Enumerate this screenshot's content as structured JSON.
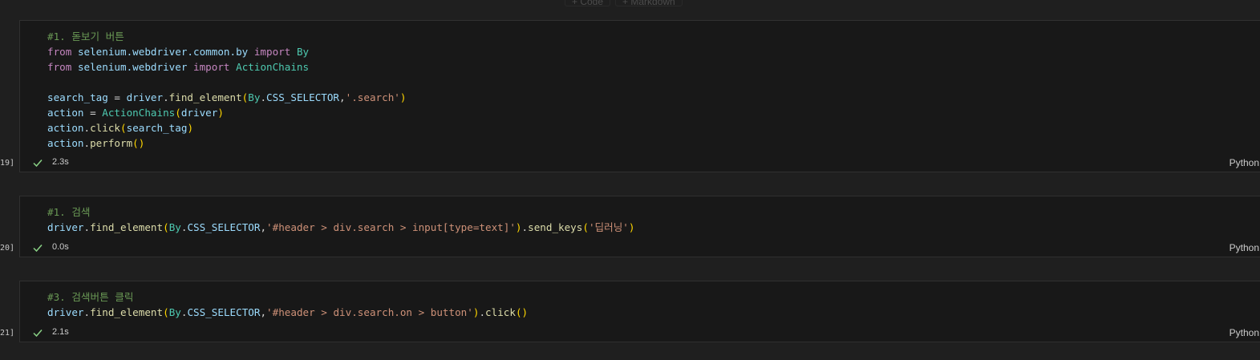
{
  "toolbar": {
    "code_label": "+ Code",
    "markdown_label": "+ Markdown"
  },
  "cells": [
    {
      "exec_count": "19]",
      "status_time": "2.3s",
      "language": "Python",
      "lines": [
        [
          {
            "c": "cmt",
            "t": "#1. 돋보기 버튼"
          }
        ],
        [
          {
            "c": "kw",
            "t": "from"
          },
          {
            "c": "op",
            "t": " "
          },
          {
            "c": "mod",
            "t": "selenium.webdriver.common.by"
          },
          {
            "c": "op",
            "t": " "
          },
          {
            "c": "kw",
            "t": "import"
          },
          {
            "c": "op",
            "t": " "
          },
          {
            "c": "cls",
            "t": "By"
          }
        ],
        [
          {
            "c": "kw",
            "t": "from"
          },
          {
            "c": "op",
            "t": " "
          },
          {
            "c": "mod",
            "t": "selenium.webdriver"
          },
          {
            "c": "op",
            "t": " "
          },
          {
            "c": "kw",
            "t": "import"
          },
          {
            "c": "op",
            "t": " "
          },
          {
            "c": "cls",
            "t": "ActionChains"
          }
        ],
        [],
        [
          {
            "c": "var",
            "t": "search_tag"
          },
          {
            "c": "op",
            "t": " = "
          },
          {
            "c": "var",
            "t": "driver"
          },
          {
            "c": "op",
            "t": "."
          },
          {
            "c": "fn",
            "t": "find_element"
          },
          {
            "c": "p1",
            "t": "("
          },
          {
            "c": "cls",
            "t": "By"
          },
          {
            "c": "op",
            "t": "."
          },
          {
            "c": "var",
            "t": "CSS_SELECTOR"
          },
          {
            "c": "op",
            "t": ","
          },
          {
            "c": "str",
            "t": "'.search'"
          },
          {
            "c": "p1",
            "t": ")"
          }
        ],
        [
          {
            "c": "var",
            "t": "action"
          },
          {
            "c": "op",
            "t": " = "
          },
          {
            "c": "cls",
            "t": "ActionChains"
          },
          {
            "c": "p1",
            "t": "("
          },
          {
            "c": "var",
            "t": "driver"
          },
          {
            "c": "p1",
            "t": ")"
          }
        ],
        [
          {
            "c": "var",
            "t": "action"
          },
          {
            "c": "op",
            "t": "."
          },
          {
            "c": "fn",
            "t": "click"
          },
          {
            "c": "p1",
            "t": "("
          },
          {
            "c": "var",
            "t": "search_tag"
          },
          {
            "c": "p1",
            "t": ")"
          }
        ],
        [
          {
            "c": "var",
            "t": "action"
          },
          {
            "c": "op",
            "t": "."
          },
          {
            "c": "fn",
            "t": "perform"
          },
          {
            "c": "p1",
            "t": "()"
          }
        ]
      ]
    },
    {
      "exec_count": "20]",
      "status_time": "0.0s",
      "language": "Python",
      "lines": [
        [
          {
            "c": "cmt",
            "t": "#1. 검색"
          }
        ],
        [
          {
            "c": "var",
            "t": "driver"
          },
          {
            "c": "op",
            "t": "."
          },
          {
            "c": "fn",
            "t": "find_element"
          },
          {
            "c": "p1",
            "t": "("
          },
          {
            "c": "cls",
            "t": "By"
          },
          {
            "c": "op",
            "t": "."
          },
          {
            "c": "var",
            "t": "CSS_SELECTOR"
          },
          {
            "c": "op",
            "t": ","
          },
          {
            "c": "str",
            "t": "'#header > div.search > input[type=text]'"
          },
          {
            "c": "p1",
            "t": ")"
          },
          {
            "c": "op",
            "t": "."
          },
          {
            "c": "fn",
            "t": "send_keys"
          },
          {
            "c": "p1",
            "t": "("
          },
          {
            "c": "str",
            "t": "'딥러닝'"
          },
          {
            "c": "p1",
            "t": ")"
          }
        ]
      ]
    },
    {
      "exec_count": "21]",
      "status_time": "2.1s",
      "language": "Python",
      "lines": [
        [
          {
            "c": "cmt",
            "t": "#3. 검색버튼 클릭"
          }
        ],
        [
          {
            "c": "var",
            "t": "driver"
          },
          {
            "c": "op",
            "t": "."
          },
          {
            "c": "fn",
            "t": "find_element"
          },
          {
            "c": "p1",
            "t": "("
          },
          {
            "c": "cls",
            "t": "By"
          },
          {
            "c": "op",
            "t": "."
          },
          {
            "c": "var",
            "t": "CSS_SELECTOR"
          },
          {
            "c": "op",
            "t": ","
          },
          {
            "c": "str",
            "t": "'#header > div.search.on > button'"
          },
          {
            "c": "p1",
            "t": ")"
          },
          {
            "c": "op",
            "t": "."
          },
          {
            "c": "fn",
            "t": "click"
          },
          {
            "c": "p1",
            "t": "()"
          }
        ]
      ]
    }
  ],
  "colors": {
    "check": "#89d185"
  }
}
